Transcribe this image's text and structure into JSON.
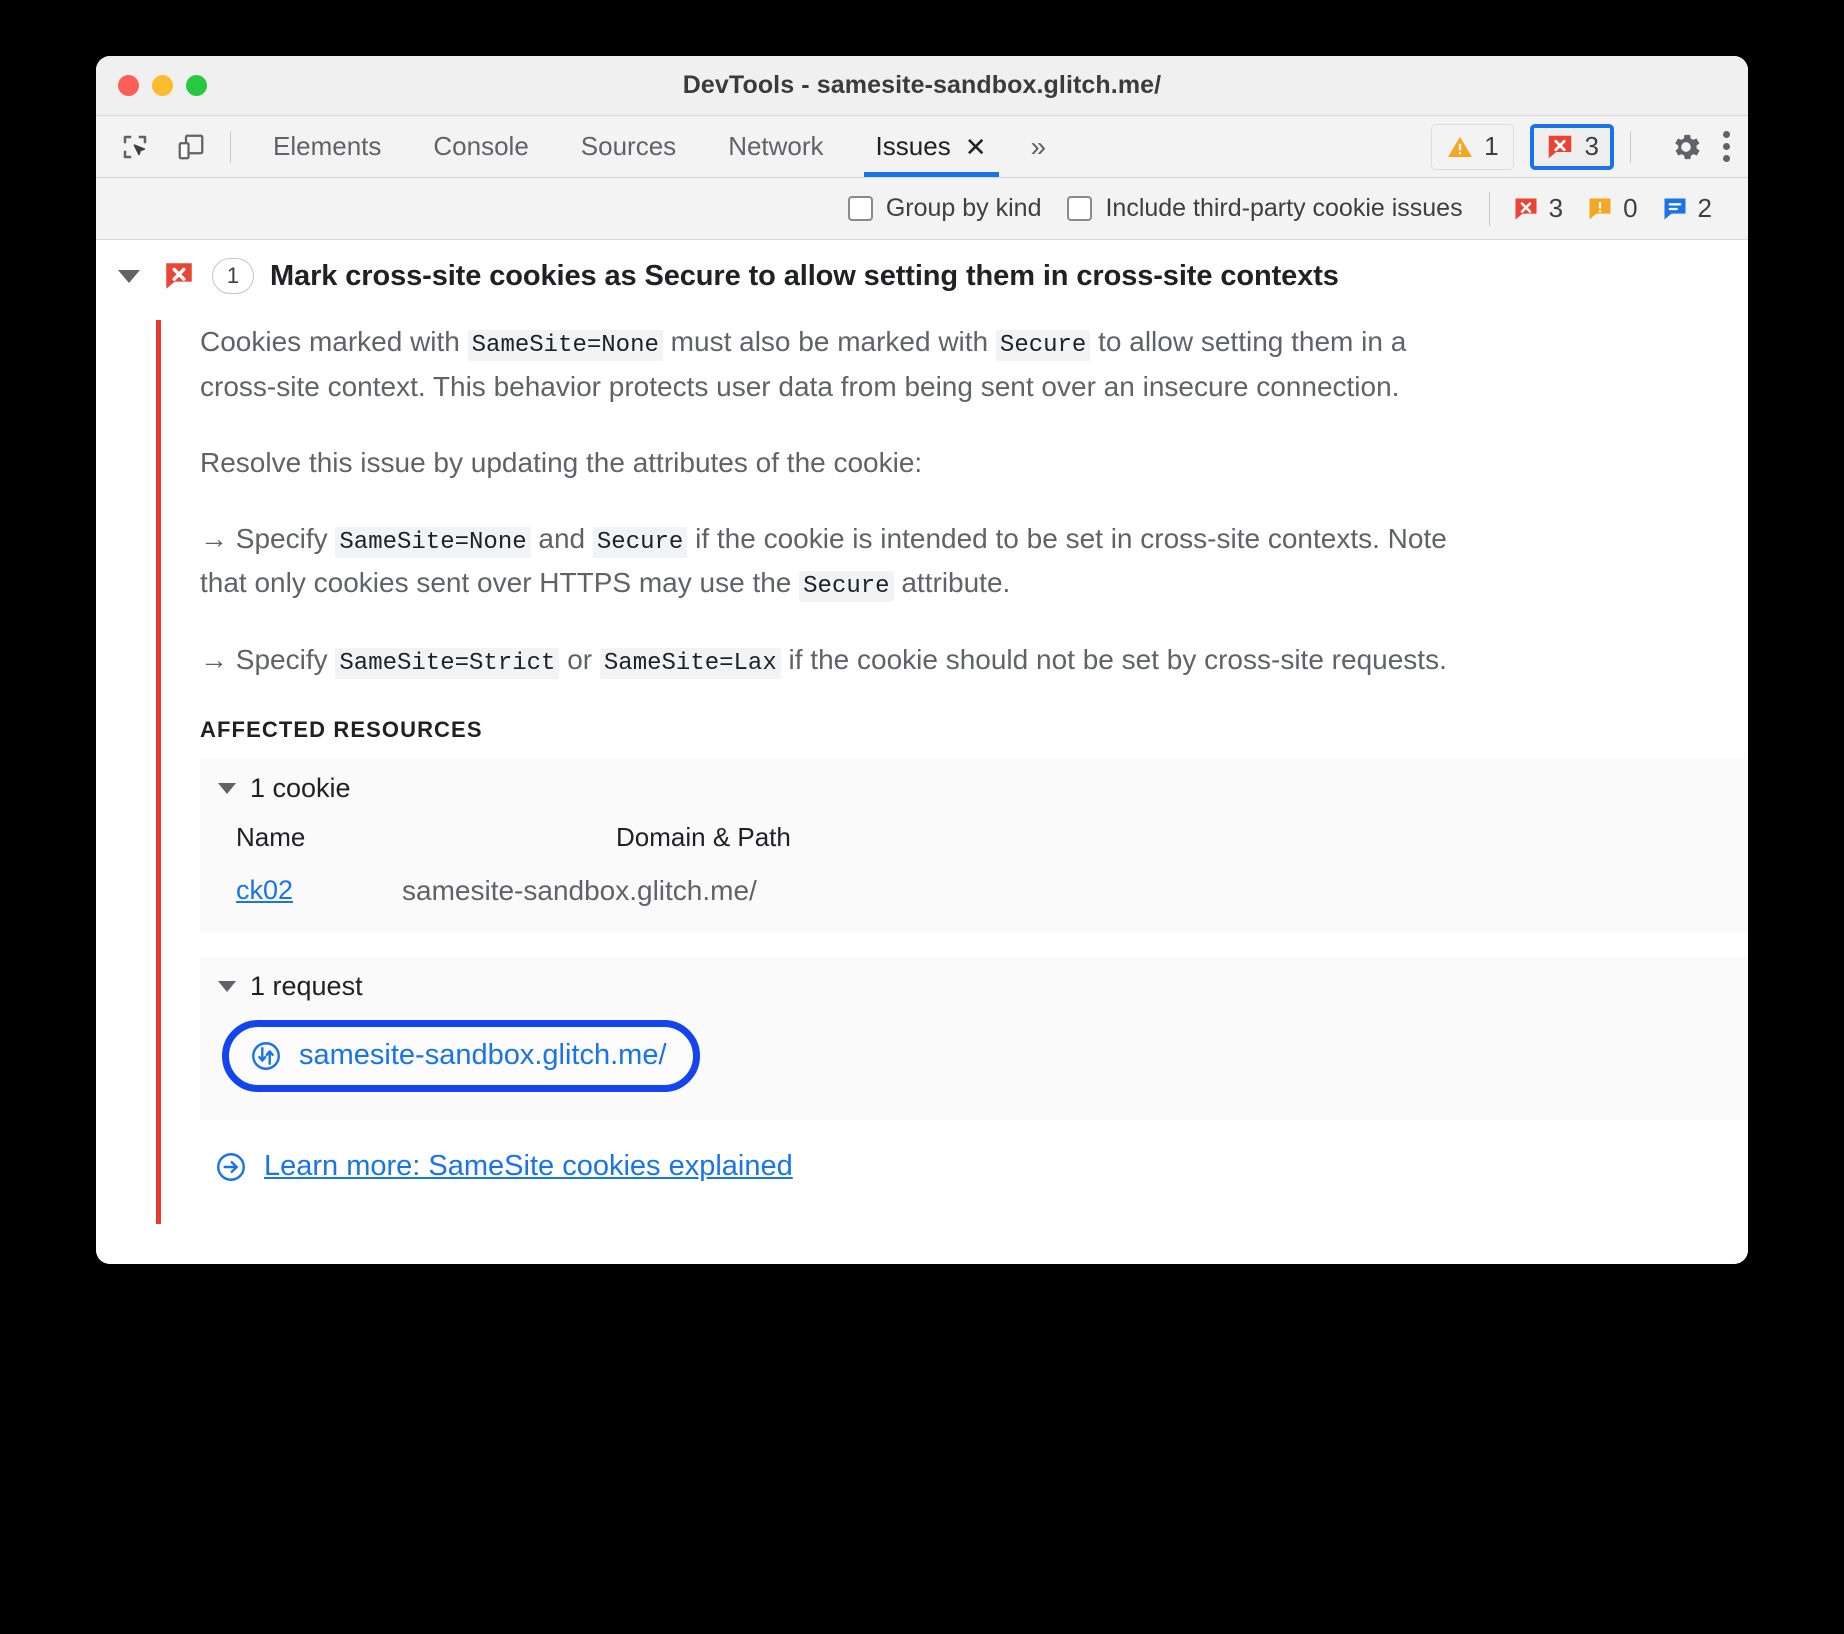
{
  "window": {
    "title": "DevTools - samesite-sandbox.glitch.me/",
    "traffic_lights": [
      "close",
      "minimize",
      "zoom"
    ]
  },
  "toolbar": {
    "inspect_icon": "inspect-element-icon",
    "device_icon": "device-toolbar-icon",
    "tabs": [
      {
        "label": "Elements",
        "active": false
      },
      {
        "label": "Console",
        "active": false
      },
      {
        "label": "Sources",
        "active": false
      },
      {
        "label": "Network",
        "active": false
      },
      {
        "label": "Issues",
        "active": true,
        "closable": true
      }
    ],
    "tab_close_glyph": "✕",
    "more_tabs_glyph": "»",
    "warning_badge": {
      "icon": "warning-triangle-icon",
      "count": "1",
      "color": "#f5a623"
    },
    "error_badge": {
      "icon": "error-flag-icon",
      "count": "3",
      "color": "#eb4335",
      "focused": true
    },
    "settings_icon": "gear-icon",
    "more_options_icon": "kebab-menu-icon"
  },
  "filterbar": {
    "group_by_kind": {
      "label": "Group by kind",
      "checked": false
    },
    "include_third_party": {
      "label": "Include third-party cookie issues",
      "checked": false
    },
    "counts": [
      {
        "icon": "error-flag-icon",
        "value": "3",
        "color": "#eb4335"
      },
      {
        "icon": "warning-flag-icon",
        "value": "0",
        "color": "#f5a623"
      },
      {
        "icon": "info-flag-icon",
        "value": "2",
        "color": "#1a73e8"
      }
    ]
  },
  "issue": {
    "expanded": true,
    "severity_icon": "error-flag-icon",
    "count": "1",
    "title": "Mark cross-site cookies as Secure to allow setting them in cross-site contexts",
    "paragraphs": [
      {
        "parts": [
          {
            "t": "text",
            "v": "Cookies marked with "
          },
          {
            "t": "code",
            "v": "SameSite=None"
          },
          {
            "t": "text",
            "v": " must also be marked with "
          },
          {
            "t": "code",
            "v": "Secure"
          },
          {
            "t": "text",
            "v": " to allow setting them in a cross-site context. This behavior protects user data from being sent over an insecure connection."
          }
        ]
      },
      {
        "parts": [
          {
            "t": "text",
            "v": "Resolve this issue by updating the attributes of the cookie:"
          }
        ]
      },
      {
        "parts": [
          {
            "t": "text",
            "v": "→  Specify "
          },
          {
            "t": "code",
            "v": "SameSite=None"
          },
          {
            "t": "text",
            "v": " and "
          },
          {
            "t": "code",
            "v": "Secure"
          },
          {
            "t": "text",
            "v": " if the cookie is intended to be set in cross-site contexts. Note that only cookies sent over HTTPS may use the "
          },
          {
            "t": "code",
            "v": "Secure"
          },
          {
            "t": "text",
            "v": " attribute."
          }
        ]
      },
      {
        "parts": [
          {
            "t": "text",
            "v": "→  Specify "
          },
          {
            "t": "code",
            "v": "SameSite=Strict"
          },
          {
            "t": "text",
            "v": " or "
          },
          {
            "t": "code",
            "v": "SameSite=Lax"
          },
          {
            "t": "text",
            "v": " if the cookie should not be set by cross-site requests."
          }
        ]
      }
    ],
    "affected_resources_label": "AFFECTED RESOURCES",
    "cookie_section": {
      "header": "1 cookie",
      "expanded": true,
      "columns": [
        "Name",
        "Domain & Path"
      ],
      "rows": [
        {
          "name": "ck02",
          "domain_path": "samesite-sandbox.glitch.me/"
        }
      ]
    },
    "request_section": {
      "header": "1 request",
      "expanded": true,
      "rows": [
        {
          "icon": "request-arrows-icon",
          "url": "samesite-sandbox.glitch.me/",
          "highlighted": true
        }
      ]
    },
    "learn_more": {
      "icon": "arrow-circle-right-icon",
      "label": "Learn more: SameSite cookies explained"
    }
  },
  "colors": {
    "accent": "#1a73e8",
    "error": "#eb4335",
    "warning": "#f5a623",
    "highlight_ring": "#1344ee",
    "issue_rail": "#e8382f"
  }
}
